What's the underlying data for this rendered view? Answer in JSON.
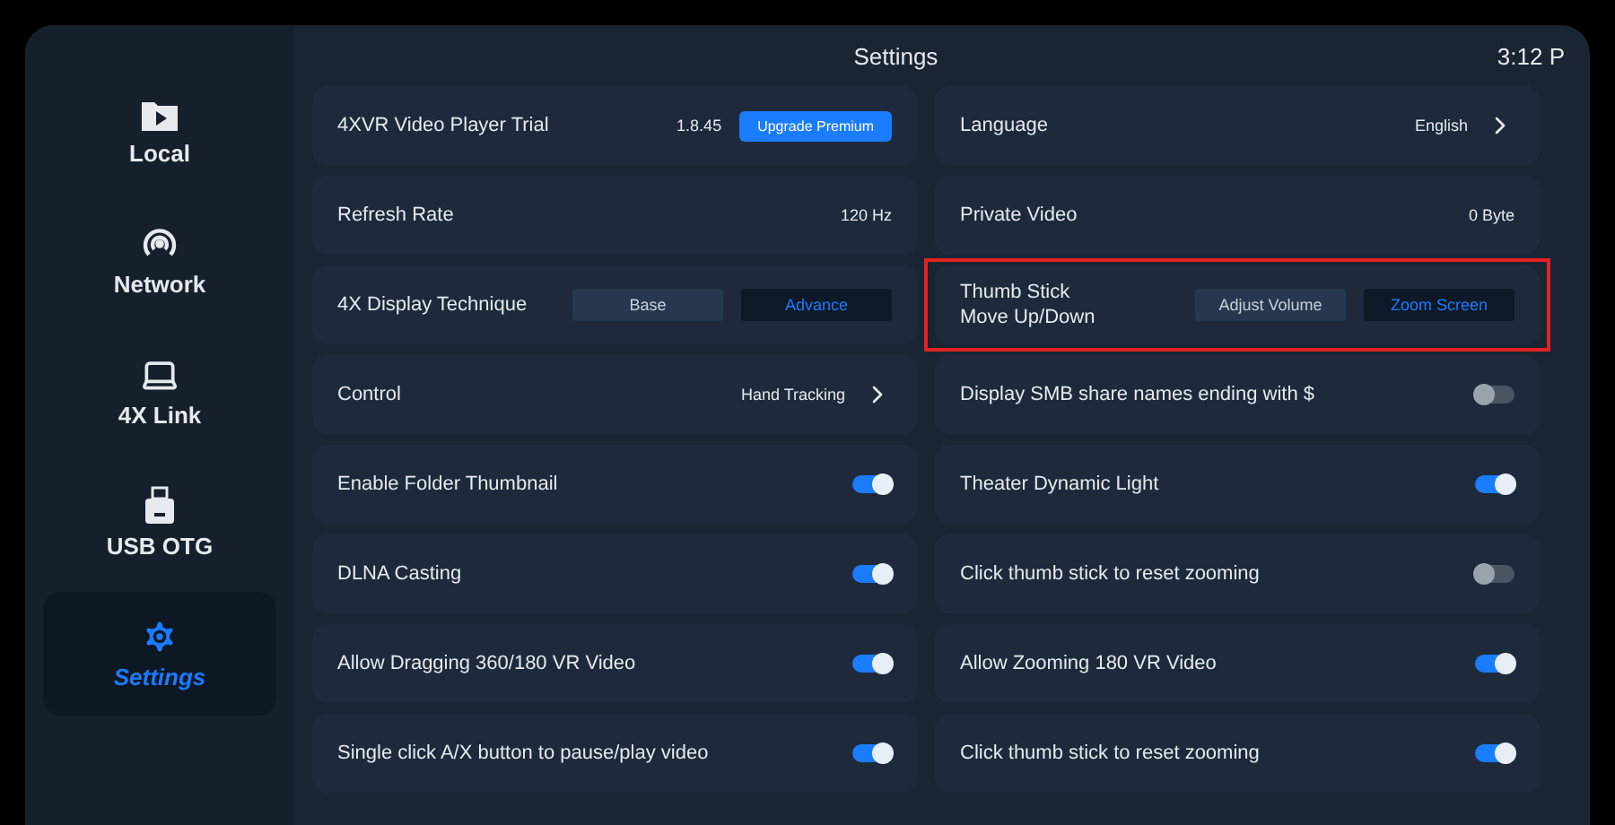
{
  "header": {
    "title": "Settings",
    "time": "3:12 P"
  },
  "sidebar": {
    "items": [
      {
        "label": "Local",
        "selected": false
      },
      {
        "label": "Network",
        "selected": false
      },
      {
        "label": "4X Link",
        "selected": false
      },
      {
        "label": "USB OTG",
        "selected": false
      },
      {
        "label": "Settings",
        "selected": true
      }
    ]
  },
  "left_settings": [
    {
      "kind": "info",
      "label": "4XVR Video Player Trial",
      "value": "1.8.45",
      "button": "Upgrade Premium"
    },
    {
      "kind": "value",
      "label": "Refresh Rate",
      "value": "120 Hz"
    },
    {
      "kind": "segmented",
      "label": "4X Display Technique",
      "options": [
        {
          "label": "Base",
          "selected": false
        },
        {
          "label": "Advance",
          "selected": true
        }
      ]
    },
    {
      "kind": "link",
      "label": "Control",
      "value": "Hand Tracking"
    },
    {
      "kind": "toggle",
      "label": "Enable Folder Thumbnail",
      "on": true
    },
    {
      "kind": "toggle",
      "label": "DLNA Casting",
      "on": true
    },
    {
      "kind": "toggle",
      "label": "Allow Dragging 360/180 VR Video",
      "on": true
    },
    {
      "kind": "toggle",
      "label": "Single click A/X button to pause/play video",
      "on": true
    }
  ],
  "right_settings": [
    {
      "kind": "link",
      "label": "Language",
      "value": "English"
    },
    {
      "kind": "value",
      "label": "Private Video",
      "value": "0 Byte"
    },
    {
      "kind": "segmented",
      "label": "Thumb Stick\nMove Up/Down",
      "highlighted": true,
      "options": [
        {
          "label": "Adjust Volume",
          "selected": false
        },
        {
          "label": "Zoom Screen",
          "selected": true
        }
      ]
    },
    {
      "kind": "toggle",
      "label": "Display SMB share names ending with $",
      "on": false
    },
    {
      "kind": "toggle",
      "label": "Theater Dynamic Light",
      "on": true
    },
    {
      "kind": "toggle",
      "label": "Click thumb stick to reset zooming",
      "on": false
    },
    {
      "kind": "toggle",
      "label": "Allow Zooming 180 VR Video",
      "on": true
    },
    {
      "kind": "toggle",
      "label": "Click thumb stick to reset zooming",
      "on": true
    }
  ]
}
